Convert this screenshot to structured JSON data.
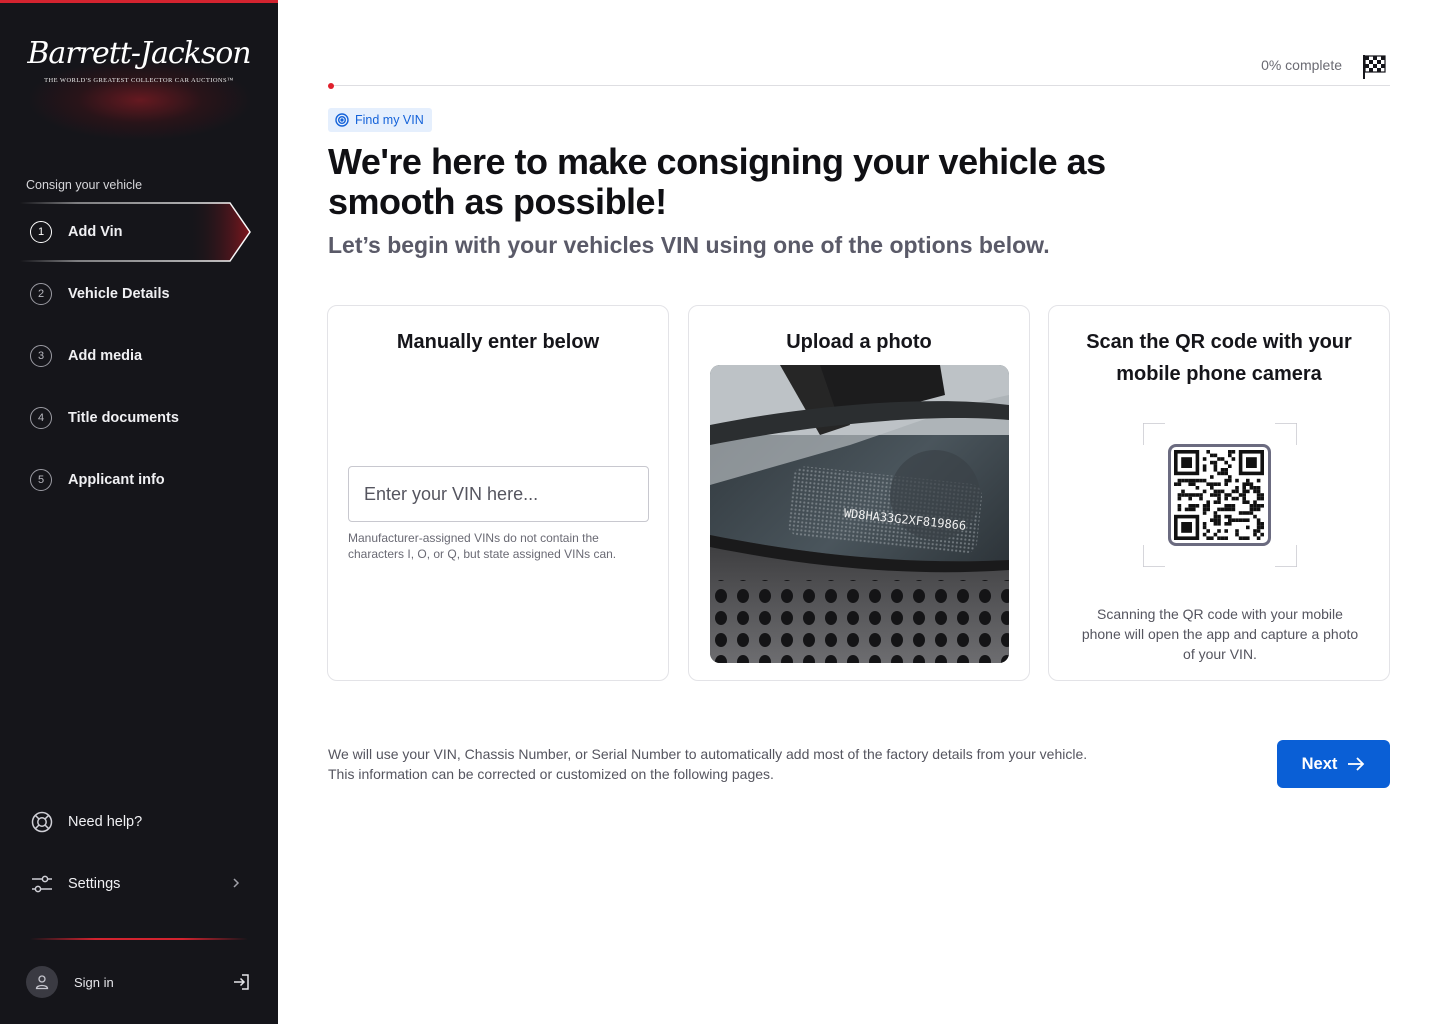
{
  "sidebar": {
    "logo": {
      "script": "Barrett-Jackson",
      "tagline": "THE WORLD'S GREATEST COLLECTOR CAR AUCTIONS™"
    },
    "section_label": "Consign your vehicle",
    "steps": [
      {
        "number": "1",
        "label": "Add Vin",
        "active": true
      },
      {
        "number": "2",
        "label": "Vehicle Details"
      },
      {
        "number": "3",
        "label": "Add media"
      },
      {
        "number": "4",
        "label": "Title documents"
      },
      {
        "number": "5",
        "label": "Applicant info"
      }
    ],
    "help_label": "Need help?",
    "settings_label": "Settings",
    "signin_label": "Sign in",
    "accent_color": "#d3232f"
  },
  "progress": {
    "text": "0% complete",
    "value": 0
  },
  "header": {
    "pill_label": "Find my VIN",
    "title": "We're here to make consigning your vehicle as smooth as possible!",
    "subtitle": "Let’s begin with your vehicles VIN using one of the options below."
  },
  "cards": {
    "manual": {
      "title": "Manually enter below",
      "input_placeholder": "Enter your VIN here...",
      "input_value": "",
      "help": "Manufacturer-assigned VINs do not contain the characters I, O, or Q, but state assigned VINs can."
    },
    "upload": {
      "title": "Upload a photo",
      "photo_vin_text": "WD8HA33G2XF819866"
    },
    "qr": {
      "title": "Scan the QR code with your mobile phone camera",
      "text": "Scanning the QR code with your mobile phone will open the app and capture a photo of your VIN."
    }
  },
  "footer": {
    "text": "We will use your VIN, Chassis Number, or Serial Number to automatically add most of the factory details from your vehicle. This information can be corrected or customized on the following pages.",
    "next_label": "Next"
  },
  "colors": {
    "primary": "#0a5fd6",
    "sidebar_bg": "#15151a",
    "pill_bg": "#e5effd",
    "pill_text": "#1462d9"
  }
}
